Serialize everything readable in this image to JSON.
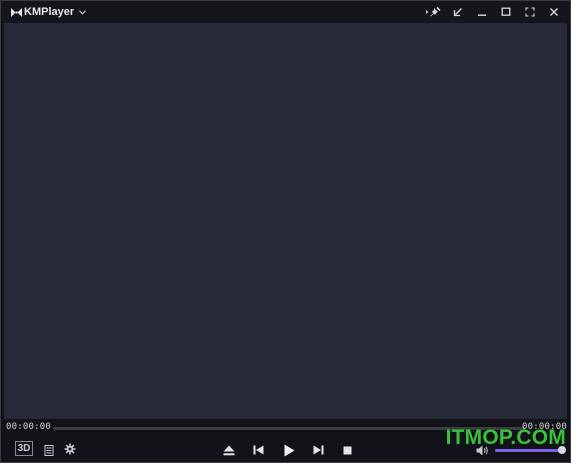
{
  "app": {
    "title": "KMPlayer"
  },
  "titlebar": {
    "buttons": [
      {
        "name": "pin-button",
        "icon": "pin-icon"
      },
      {
        "name": "minimal-mode-button",
        "icon": "shrink-arrow-icon"
      },
      {
        "name": "minimize-button",
        "icon": "minimize-icon"
      },
      {
        "name": "maximize-button",
        "icon": "maximize-icon"
      },
      {
        "name": "fullscreen-button",
        "icon": "fullscreen-icon"
      },
      {
        "name": "close-button",
        "icon": "close-icon"
      }
    ]
  },
  "playback": {
    "current_time": "00:00:00",
    "total_time": "00:00:00",
    "progress": 0
  },
  "controls": {
    "badge_3d": "3D",
    "volume_level": 0.98
  },
  "watermark": {
    "text": "ITMOP.COM"
  },
  "colors": {
    "video_background": "#262938",
    "chrome_background": "#121318",
    "volume_accent": "#7b62e6",
    "watermark": "#3cbf3a"
  }
}
